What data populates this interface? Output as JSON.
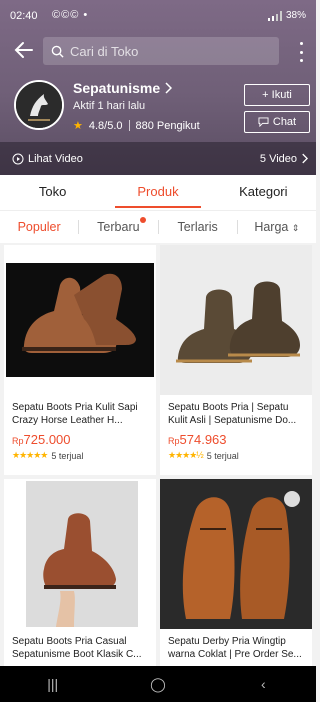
{
  "status": {
    "time": "02:40",
    "left_icons": "©©© •",
    "battery": "38%"
  },
  "search": {
    "placeholder": "Cari di Toko"
  },
  "shop": {
    "name": "Sepatunisme",
    "active": "Aktif 1 hari lalu",
    "rating": "4.8/5.0",
    "followers": "880 Pengikut",
    "follow_label": "+ Ikuti",
    "chat_label": "Chat",
    "video_label": "Lihat Video",
    "video_count": "5 Video"
  },
  "tabs": [
    {
      "label": "Toko"
    },
    {
      "label": "Produk"
    },
    {
      "label": "Kategori"
    }
  ],
  "sorts": [
    {
      "label": "Populer"
    },
    {
      "label": "Terbaru"
    },
    {
      "label": "Terlaris"
    },
    {
      "label": "Harga"
    }
  ],
  "products": [
    {
      "title": "Sepatu Boots Pria Kulit Sapi Crazy Horse Leather H...",
      "currency": "Rp",
      "price": "725.000",
      "sold": "5 terjual"
    },
    {
      "title": "Sepatu Boots Pria | Sepatu Kulit Asli | Sepatunisme Do...",
      "currency": "Rp",
      "price": "574.963",
      "sold": "5 terjual"
    },
    {
      "title": "Sepatu Boots Pria Casual Sepatunisme Boot Klasik C...",
      "currency": "",
      "price": "",
      "sold": ""
    },
    {
      "title": "Sepatu Derby Pria Wingtip warna Coklat | Pre Order Se...",
      "currency": "",
      "price": "",
      "sold": ""
    }
  ],
  "colors": {
    "accent": "#ee4d2d",
    "header": "#6f5f77",
    "star": "#ffb400"
  }
}
